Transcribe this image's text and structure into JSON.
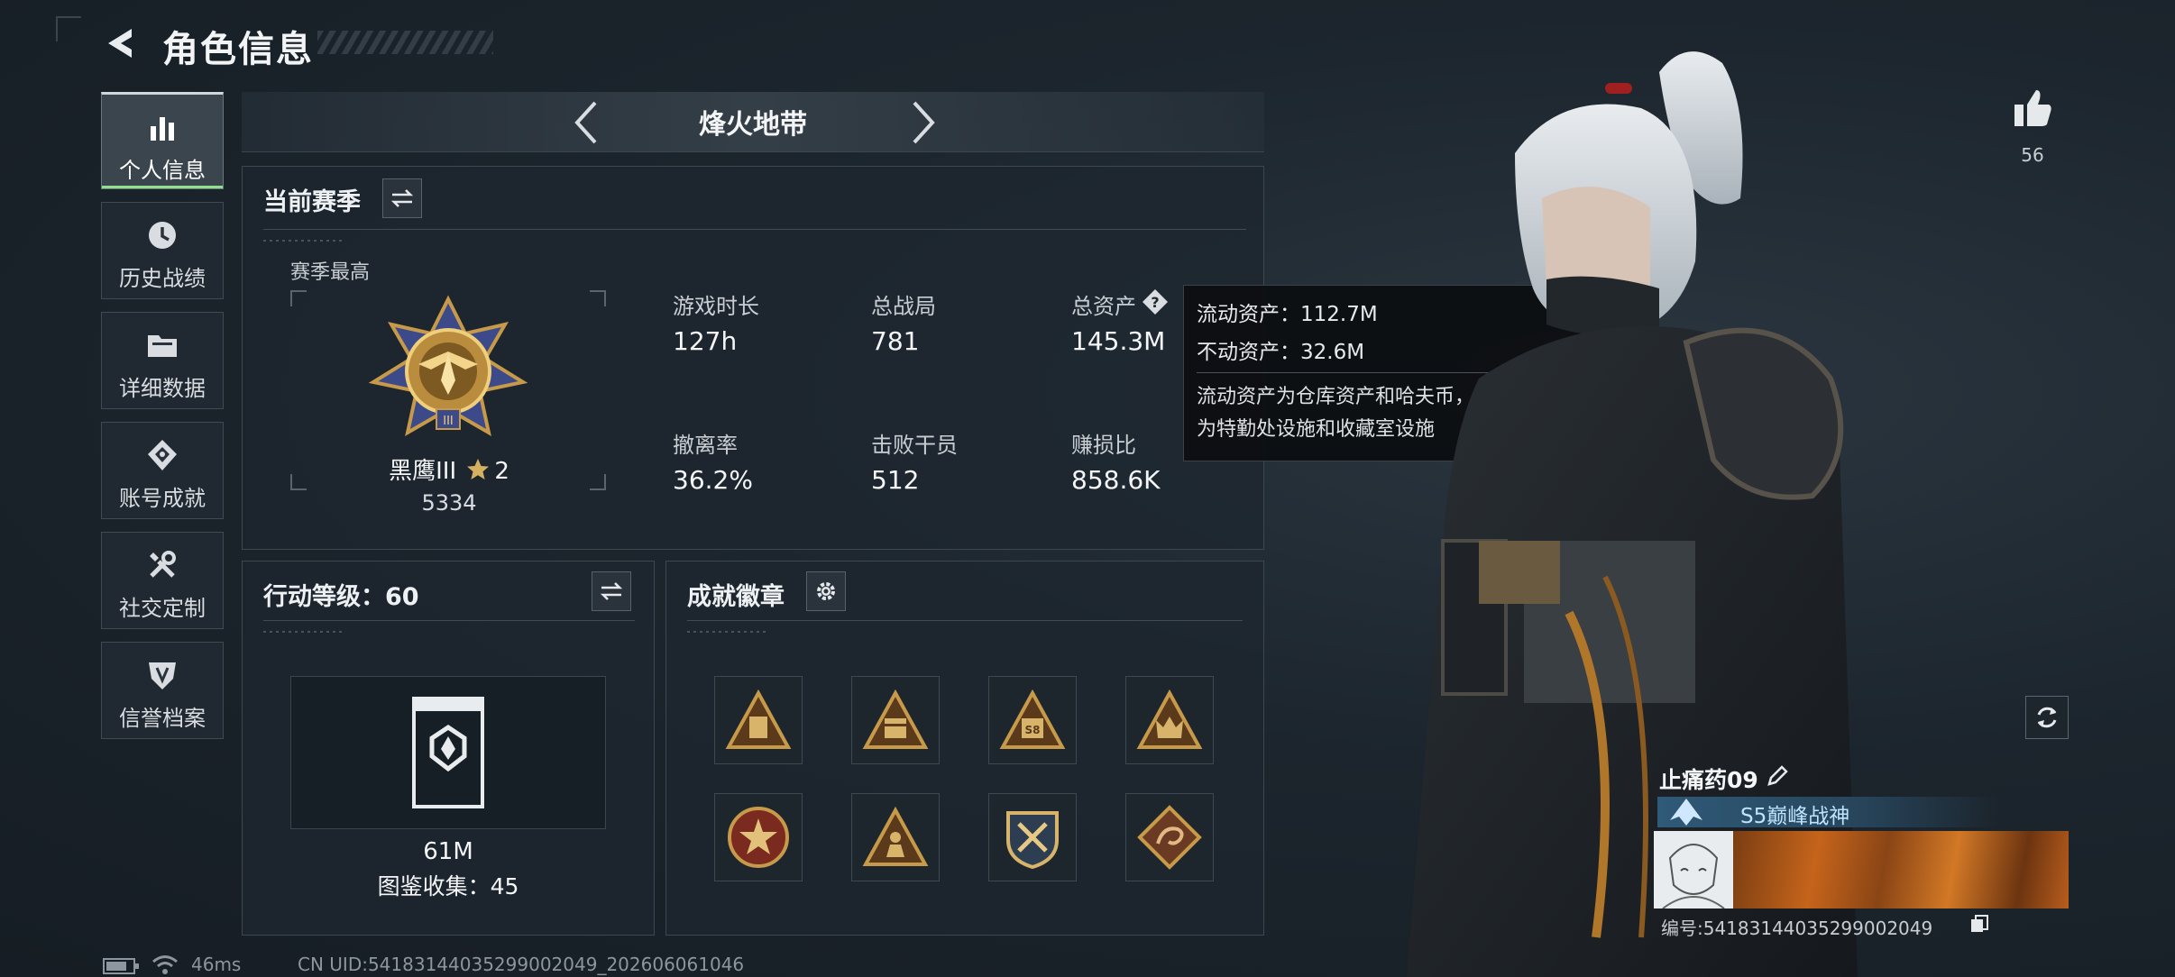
{
  "header": {
    "title": "角色信息"
  },
  "nav": {
    "items": [
      {
        "label": "个人信息",
        "icon": "bar-chart-icon",
        "active": true
      },
      {
        "label": "历史战绩",
        "icon": "clock-icon",
        "active": false
      },
      {
        "label": "详细数据",
        "icon": "folder-icon",
        "active": false
      },
      {
        "label": "账号成就",
        "icon": "diamond-badge-icon",
        "active": false
      },
      {
        "label": "社交定制",
        "icon": "tools-icon",
        "active": false
      },
      {
        "label": "信誉档案",
        "icon": "shield-icon",
        "active": false
      }
    ]
  },
  "mode": {
    "label": "烽火地带"
  },
  "season": {
    "title": "当前赛季",
    "best_label": "赛季最高",
    "rank_name": "黑鹰III",
    "rank_stars": "2",
    "rank_score": "5334",
    "stats": [
      {
        "label": "游戏时长",
        "value": "127h"
      },
      {
        "label": "总战局",
        "value": "781"
      },
      {
        "label": "总资产",
        "value": "145.3M"
      },
      {
        "label": "撤离率",
        "value": "36.2%"
      },
      {
        "label": "击败干员",
        "value": "512"
      },
      {
        "label": "赚损比",
        "value": "858.6K"
      }
    ]
  },
  "tooltip": {
    "liquid": "流动资产：112.7M",
    "fixed": "不动资产：32.6M",
    "desc_line1": "流动资产为仓库资产和哈夫币，不动资产",
    "desc_line2": "为特勤处设施和收藏室设施"
  },
  "action_level": {
    "title": "行动等级：60",
    "value": "61M",
    "collection": "图鉴收集：45"
  },
  "achievements": {
    "title": "成就徽章",
    "badges": [
      {
        "icon": "triangle-badge-armor-icon"
      },
      {
        "icon": "triangle-badge-box-icon"
      },
      {
        "icon": "triangle-badge-s8-icon"
      },
      {
        "icon": "triangle-badge-crown-icon"
      },
      {
        "icon": "round-star-badge-icon"
      },
      {
        "icon": "triangle-soldier-badge-icon"
      },
      {
        "icon": "crossed-swords-badge-icon"
      },
      {
        "icon": "dragon-diamond-badge-icon"
      }
    ]
  },
  "social": {
    "likes": "56"
  },
  "player": {
    "name": "止痛药09",
    "title": "S5巅峰战神",
    "id": "编号:54183144035299002049"
  },
  "status": {
    "ping": "46ms",
    "uid": "CN UID:54183144035299002049_202606061046"
  },
  "colors": {
    "accent_green": "#8fe08a",
    "gold": "#c79a4a",
    "title_blue": "#bfe4ff"
  }
}
